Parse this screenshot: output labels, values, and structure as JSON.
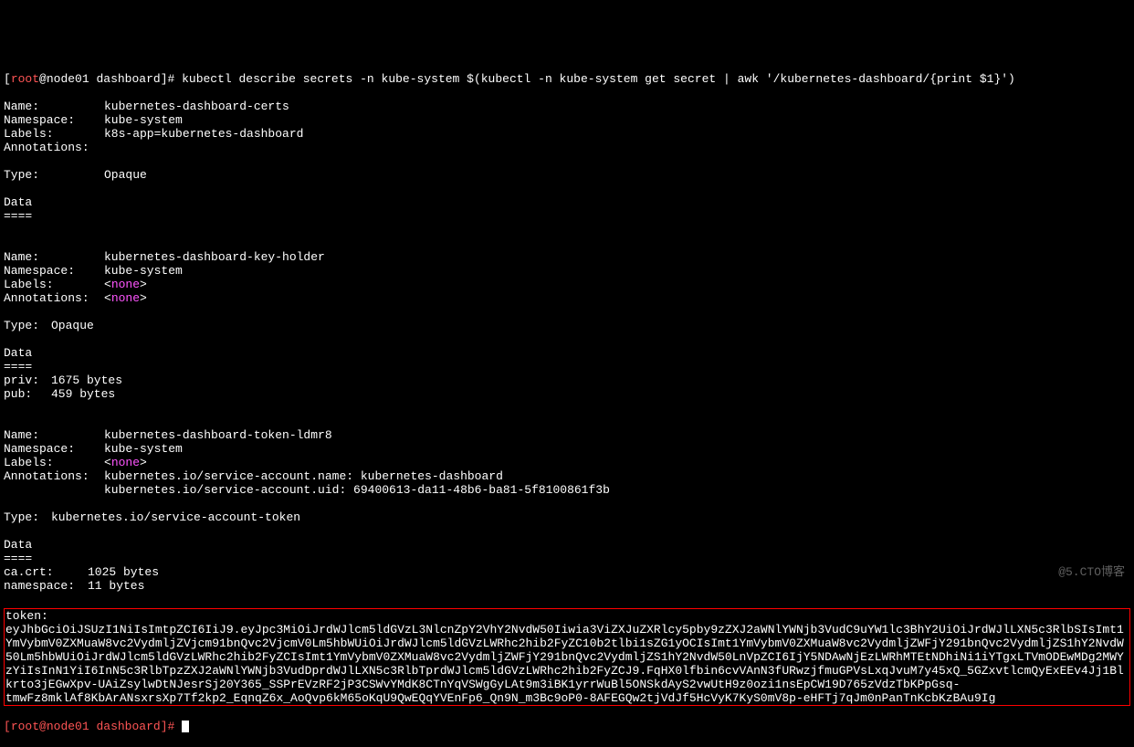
{
  "prompt_user": "root",
  "prompt_host": "node01",
  "prompt_dir": "dashboard",
  "command": "kubectl describe secrets -n kube-system $(kubectl -n kube-system get secret | awk '/kubernetes-dashboard/{print $1}')",
  "secrets": [
    {
      "name": "kubernetes-dashboard-certs",
      "namespace": "kube-system",
      "labels": "k8s-app=kubernetes-dashboard",
      "annotations": "",
      "type": "Opaque",
      "type_wide": true,
      "data_header": "Data",
      "data_divider": "====",
      "data": []
    },
    {
      "name": "kubernetes-dashboard-key-holder",
      "namespace": "kube-system",
      "labels_none": "none",
      "annotations_none": "none",
      "type": "Opaque",
      "type_wide": false,
      "data_header": "Data",
      "data_divider": "====",
      "data": [
        {
          "key": "priv:",
          "value": "1675 bytes"
        },
        {
          "key": "pub:",
          "value": "459 bytes"
        }
      ]
    },
    {
      "name": "kubernetes-dashboard-token-ldmr8",
      "namespace": "kube-system",
      "labels_none": "none",
      "annotations_list": [
        "kubernetes.io/service-account.name: kubernetes-dashboard",
        "kubernetes.io/service-account.uid: 69400613-da11-48b6-ba81-5f8100861f3b"
      ],
      "type": "kubernetes.io/service-account-token",
      "type_wide": false,
      "data_header": "Data",
      "data_divider": "====",
      "data": [
        {
          "key": "ca.crt:",
          "value": "1025 bytes",
          "wide": true
        },
        {
          "key": "namespace:",
          "value": "11 bytes",
          "wide": true
        }
      ]
    }
  ],
  "token_label": "token:",
  "token_value": "eyJhbGciOiJSUzI1NiIsImtpZCI6IiJ9.eyJpc3MiOiJrdWJlcm5ldGVzL3NlcnZpY2VhY2NvdW50Iiwia3ViZXJuZXRlcy5pby9zZXJ2aWNlYWNjb3VudC9uYW1lc3BhY2UiOiJrdWJlLXN5c3RlbSIsImt1YmVybmV0ZXMuaW8vc2VydmljZVjcm91bnQvc2VjcmV0Lm5hbWUiOiJrdWJlcm5ldGVzLWRhc2hib2FyZC10b2tlbi1sZG1yOCIsImt1YmVybmV0ZXMuaW8vc2VydmljZWFjY291bnQvc2VydmljZS1hY2NvdW50Lm5hbWUiOiJrdWJlcm5ldGVzLWRhc2hib2FyZCIsImt1YmVybmV0ZXMuaW8vc2VydmljZWFjY291bnQvc2VydmljZS1hY2NvdW50LnVpZCI6IjY5NDAwNjEzLWRhMTEtNDhiNi1iYTgxLTVmODEwMDg2MWYzYiIsInN1YiI6InN5c3RlbTpzZXJ2aWNlYWNjb3VudDprdWJlLXN5c3RlbTprdWJlcm5ldGVzLWRhc2hib2FyZCJ9.FqHX0lfbin6cvVAnN3fURwzjfmuGPVsLxqJvuM7y45xQ_5GZxvtlcmQyExEEv4Jj1Blkrto3jEGwXpv-UAiZsylwDtNJesrSj20Y365_SSPrEVzRF2jP3CSWvYMdK8CTnYqVSWgGyLAt9m3iBK1yrrWuBl5ONSkdAyS2vwUtH9z0ozi1nsEpCW19D765zVdzTbKPpGsq-tmwFz8mklAf8KbArANsxrsXp7Tf2kp2_EqnqZ6x_AoQvp6kM65oKqU9QwEQqYVEnFp6_Qn9N_m3Bc9oP0-8AFEGQw2tjVdJf5HcVyK7KyS0mV8p-eHFTj7qJm0nPanTnKcbKzBAu9Ig",
  "final_prompt_text": "[root@node01 dashboard]# ",
  "watermark": "@5.CTO博客",
  "labels": {
    "name": "Name:",
    "namespace": "Namespace:",
    "labels": "Labels:",
    "annotations": "Annotations:",
    "type": "Type:"
  }
}
